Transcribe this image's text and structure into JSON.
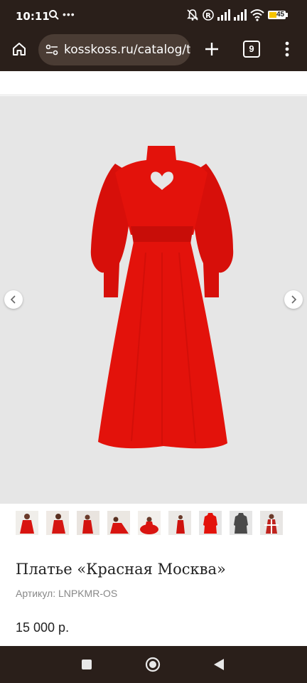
{
  "status": {
    "time": "10:11",
    "battery": "45"
  },
  "browser": {
    "url": "kosskoss.ru/catalog/tp",
    "tab_count": "9"
  },
  "gallery": {
    "thumbnail_count": 9,
    "thumbnails": [
      "Фото 1",
      "Фото 2",
      "Фото 3",
      "Фото 4",
      "Фото 5",
      "Фото 6",
      "Фото 7",
      "Фото 8",
      "Фото 9"
    ],
    "dress_color": "#e3120b",
    "background_color": "#e6e6e6"
  },
  "product": {
    "title": "Платье «Красная Москва»",
    "sku": "Артикул: LNPKMR-OS",
    "price": "15 000 р."
  },
  "icons": {
    "home": "home-icon",
    "site_settings": "tune-icon",
    "new_tab": "plus-icon",
    "menu": "more-vert-icon",
    "prev": "chevron-left-icon",
    "next": "chevron-right-icon",
    "recents": "square-icon",
    "home_nav": "circle-icon",
    "back": "triangle-back-icon"
  }
}
